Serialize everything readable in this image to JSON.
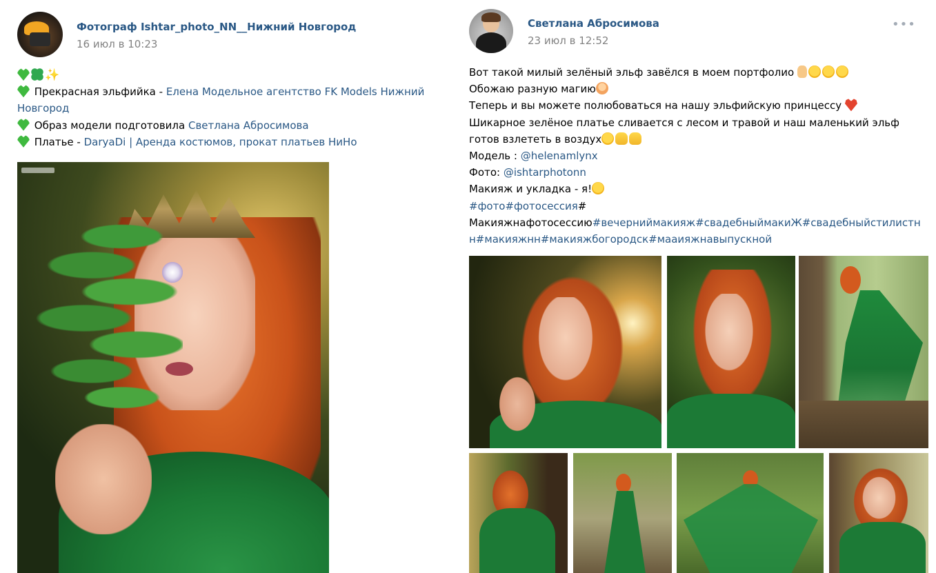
{
  "left_post": {
    "author": "Фотограф Ishtar_photo_NN__Нижний Новгород",
    "date": "16 июл в 10:23",
    "lines": [
      {
        "prefix": "Прекрасная эльфийка - ",
        "link": "Елена Модельное агентство FK Models Нижний",
        "link_cont": "Новгород"
      },
      {
        "prefix": "Образ модели подготовила ",
        "link": "Светлана Абросимова"
      },
      {
        "prefix": "Платье - ",
        "link": "DaryaDi | Аренда костюмов, прокат платьев НиНо"
      }
    ]
  },
  "right_post": {
    "author": "Светлана Абросимова",
    "date": "23 июл в 12:52",
    "more": "•••",
    "text": {
      "l1": "Вот такой милый зелёный эльф завёлся в моем портфолио",
      "l2": "Обожаю разную магию",
      "l3": "Теперь и вы можете полюбоваться на нашу эльфийскую принцессу",
      "l4": "Шикарное зелёное платье сливается с лесом и травой и наш маленький эльф",
      "l5": "готов взлететь в воздух",
      "l6_prefix": "Модель : ",
      "l6_link": "@helenamlynx",
      "l7_prefix": "Фото: ",
      "l7_link": "@ishtarphotonn",
      "l8": "Макияж и укладка - я!",
      "l9_link": "#фото#фотосессия",
      "l9_suffix": "#",
      "l10_prefix": "Макияжнафотосессию",
      "l10_link": "#вечерниймакияж#свадебныймакиЖ#свадебныйстилистн",
      "l11_link": "н#макияжнн#макияжбогородск#мааияжнавыпускной"
    }
  },
  "icons": [
    "green-heart-icon",
    "clover-icon",
    "sparkles-icon",
    "finger-icon",
    "laughing-face-icon",
    "girl-icon",
    "red-heart-icon",
    "zany-face-icon",
    "raised-hands-icon"
  ],
  "colors": {
    "link": "#2a5885",
    "date": "#828282",
    "dress_green": "#1b7a35",
    "hair": "#d2561e"
  }
}
